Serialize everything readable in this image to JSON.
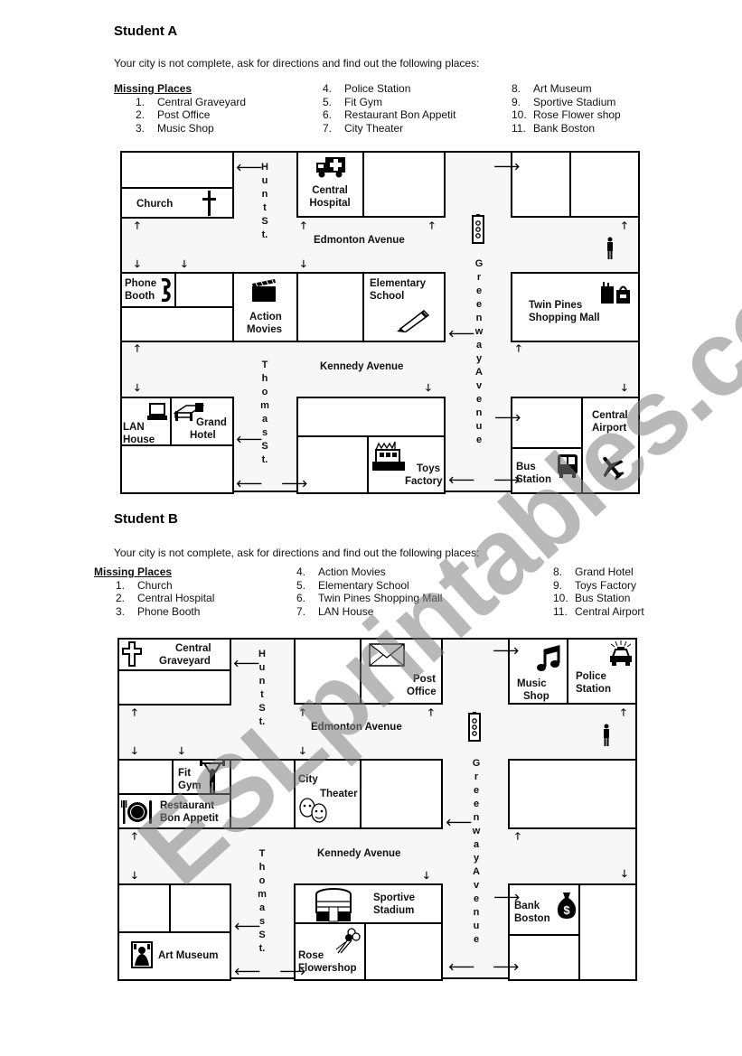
{
  "watermark": "ESLprintables.com",
  "student_a": {
    "heading": "Student A",
    "intro": "Your city is not complete, ask for directions and find out the following places:",
    "missing_title": "Missing Places",
    "missing": [
      {
        "n": "1.",
        "name": "Central Graveyard"
      },
      {
        "n": "2.",
        "name": "Post Office"
      },
      {
        "n": "3.",
        "name": "Music Shop"
      },
      {
        "n": "4.",
        "name": "Police Station"
      },
      {
        "n": "5.",
        "name": "Fit Gym"
      },
      {
        "n": "6.",
        "name": "Restaurant Bon Appetit"
      },
      {
        "n": "7.",
        "name": "City Theater"
      },
      {
        "n": "8.",
        "name": "Art Museum"
      },
      {
        "n": "9.",
        "name": "Sportive Stadium"
      },
      {
        "n": "10.",
        "name": "Rose Flower shop"
      },
      {
        "n": "11.",
        "name": "Bank Boston"
      }
    ],
    "map": {
      "streets": {
        "hunt": "Hunt  St.",
        "thomas": "Thomas  St.",
        "greenway": "Greenway  Avenue",
        "edmonton": "Edmonton Avenue",
        "kennedy": "Kennedy Avenue"
      },
      "places": {
        "church": "Church",
        "hospital_1": "Central",
        "hospital_2": "Hospital",
        "phone_1": "Phone",
        "phone_2": "Booth",
        "movies_1": "Action",
        "movies_2": "Movies",
        "school_1": "Elementary",
        "school_2": "School",
        "mall_1": "Twin Pines",
        "mall_2": "Shopping Mall",
        "lan_1": "LAN",
        "lan_2": "House",
        "hotel_1": "Grand",
        "hotel_2": "Hotel",
        "toys_1": "Toys",
        "toys_2": "Factory",
        "bus_1": "Bus",
        "bus_2": "Station",
        "airport_1": "Central",
        "airport_2": "Airport"
      }
    }
  },
  "student_b": {
    "heading": "Student B",
    "intro": "Your city is not complete, ask for directions and find out the following places:",
    "missing_title": "Missing Places",
    "missing": [
      {
        "n": "1.",
        "name": "Church"
      },
      {
        "n": "2.",
        "name": "Central Hospital"
      },
      {
        "n": "3.",
        "name": "Phone Booth"
      },
      {
        "n": "4.",
        "name": "Action Movies"
      },
      {
        "n": "5.",
        "name": "Elementary School"
      },
      {
        "n": "6.",
        "name": "Twin Pines Shopping Mall"
      },
      {
        "n": "7.",
        "name": "LAN House"
      },
      {
        "n": "8.",
        "name": "Grand Hotel"
      },
      {
        "n": "9.",
        "name": "Toys Factory"
      },
      {
        "n": "10.",
        "name": "Bus Station"
      },
      {
        "n": "11.",
        "name": "Central Airport"
      }
    ],
    "map": {
      "streets": {
        "hunt": "Hunt  St.",
        "thomas": "Thomas  St.",
        "greenway": "Greenway  Avenue",
        "edmonton": "Edmonton Avenue",
        "kennedy": "Kennedy Avenue"
      },
      "places": {
        "graveyard_1": "Central",
        "graveyard_2": "Graveyard",
        "post_1": "Post",
        "post_2": "Office",
        "music_1": "Music",
        "music_2": "Shop",
        "police_1": "Police",
        "police_2": "Station",
        "gym_1": "Fit",
        "gym_2": "Gym",
        "restaurant_1": "Restaurant",
        "restaurant_2": "Bon Appetit",
        "theater_1": "City",
        "theater_2": "Theater",
        "museum": "Art Museum",
        "stadium_1": "Sportive",
        "stadium_2": "Stadium",
        "rose_1": "Rose",
        "rose_2": "Flowershop",
        "bank_1": "Bank",
        "bank_2": "Boston"
      }
    }
  },
  "arrows": {
    "up": "🡑",
    "down": "🡓",
    "left": "🡐",
    "right": "🡒"
  }
}
